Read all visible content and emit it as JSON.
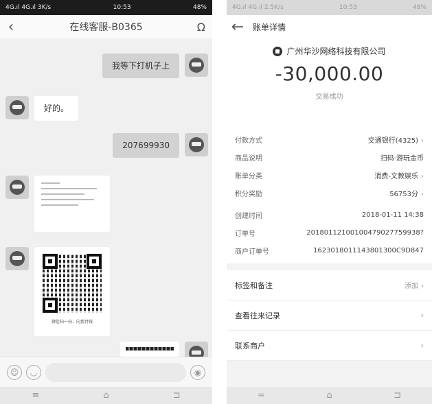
{
  "chat": {
    "status": {
      "left": "4G.ıl 4G.ıl 3K/s",
      "time": "10:53",
      "right": "48%"
    },
    "title": "在线客服-B0365",
    "messages": {
      "m1": "我等下打机子上",
      "m2": "好的。",
      "m3": "207699930"
    },
    "qr_caption": "微信扫一扫，向我付钱",
    "icons": {
      "emoji": "☺",
      "sticker": "◡",
      "voice": "◉"
    },
    "sysnav": {
      "menu": "≡",
      "home": "⌂",
      "back": "⊐"
    }
  },
  "bill": {
    "status": {
      "left": "4G.ıl 4G.ıl 2.5K/s",
      "time": "10:53",
      "right": "48%"
    },
    "title": "账单详情",
    "merchant": "广州华沙网络科技有限公司",
    "amount": "-30,000.00",
    "trade_status": "交易成功",
    "rows": [
      {
        "label": "付款方式",
        "value": "交通银行(4325)",
        "chevron": true
      },
      {
        "label": "商品说明",
        "value": "扫码·游玩金币",
        "chevron": false
      },
      {
        "label": "账单分类",
        "value": "消费-文教娱乐",
        "chevron": true
      },
      {
        "label": "积分奖励",
        "value": "56753分",
        "chevron": true
      },
      {
        "label": "创建时间",
        "value": "2018-01-11 14:38",
        "chevron": false
      },
      {
        "label": "订单号",
        "value": "20180112100100479027759938?",
        "chevron": false
      },
      {
        "label": "商户订单号",
        "value": "1623018011143801300C9D847",
        "chevron": false
      }
    ],
    "actions": [
      {
        "label": "标签和备注",
        "value": "添加",
        "chevron": true
      },
      {
        "label": "查看往来记录",
        "value": "",
        "chevron": true
      },
      {
        "label": "联系商户",
        "value": "",
        "chevron": true
      }
    ],
    "sysnav": {
      "menu": "=",
      "home": "⌂",
      "back": "⊐"
    }
  }
}
